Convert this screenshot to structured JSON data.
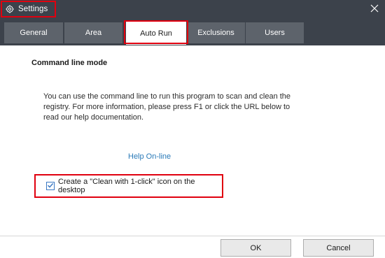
{
  "window": {
    "title": "Settings",
    "title_icon": "gear-icon",
    "close_icon": "close-icon"
  },
  "tabs": [
    {
      "label": "General",
      "active": false
    },
    {
      "label": "Area",
      "active": false
    },
    {
      "label": "Auto Run",
      "active": true
    },
    {
      "label": "Exclusions",
      "active": false
    },
    {
      "label": "Users",
      "active": false
    }
  ],
  "content": {
    "heading": "Command line mode",
    "description": "You can use the command line to run this program to scan and clean the registry. For more information, please press F1 or click the URL below to read our help documentation.",
    "help_link": "Help On-line",
    "checkbox_label": "Create a \"Clean with 1-click\" icon on the desktop",
    "checkbox_checked": true
  },
  "footer": {
    "ok_label": "OK",
    "cancel_label": "Cancel"
  },
  "colors": {
    "titlebar_bg": "#3c424b",
    "tab_inactive_bg": "#5d636b",
    "highlight_red": "#e0000f",
    "link_blue": "#2a7ab8",
    "checkbox_blue": "#3a78c3"
  }
}
